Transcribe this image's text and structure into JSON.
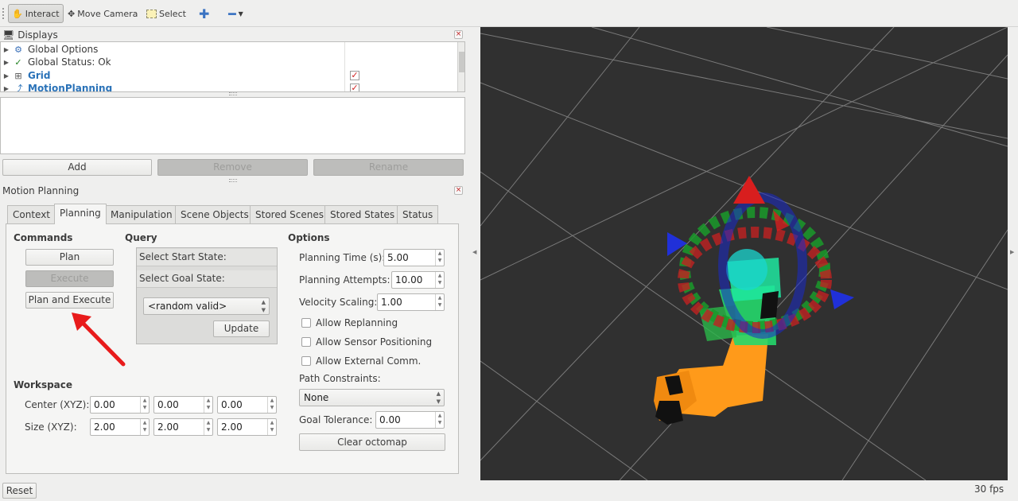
{
  "toolbar": {
    "interact": "Interact",
    "move_camera": "Move Camera",
    "select": "Select"
  },
  "displays": {
    "title": "Displays",
    "items": [
      {
        "label": "Global Options"
      },
      {
        "label": "Global Status: Ok"
      },
      {
        "label": "Grid"
      },
      {
        "label": "MotionPlanning"
      }
    ],
    "buttons": {
      "add": "Add",
      "remove": "Remove",
      "rename": "Rename"
    }
  },
  "motion_planning": {
    "title": "Motion Planning",
    "tabs": [
      "Context",
      "Planning",
      "Manipulation",
      "Scene Objects",
      "Stored Scenes",
      "Stored States",
      "Status"
    ],
    "commands": {
      "header": "Commands",
      "plan": "Plan",
      "execute": "Execute",
      "plan_and_execute": "Plan and Execute"
    },
    "query": {
      "header": "Query",
      "select_start": "Select Start State:",
      "select_goal": "Select Goal State:",
      "goal_option": "<random valid>",
      "update": "Update"
    },
    "options": {
      "header": "Options",
      "planning_time_label": "Planning Time (s):",
      "planning_time": "5.00",
      "planning_attempts_label": "Planning Attempts:",
      "planning_attempts": "10.00",
      "velocity_scaling_label": "Velocity Scaling:",
      "velocity_scaling": "1.00",
      "allow_replanning": "Allow Replanning",
      "allow_sensor": "Allow Sensor Positioning",
      "allow_external": "Allow External Comm.",
      "path_constraints_label": "Path Constraints:",
      "path_constraints": "None",
      "goal_tolerance_label": "Goal Tolerance:",
      "goal_tolerance": "0.00",
      "clear_octomap": "Clear octomap"
    },
    "workspace": {
      "header": "Workspace",
      "center_label": "Center (XYZ):",
      "center": [
        "0.00",
        "0.00",
        "0.00"
      ],
      "size_label": "Size (XYZ):",
      "size": [
        "2.00",
        "2.00",
        "2.00"
      ]
    }
  },
  "statusbar": {
    "reset": "Reset",
    "fps": "30 fps"
  },
  "colors": {
    "viewport_bg": "#303030",
    "accent_blue": "#2a72b8",
    "annotation_arrow": "#e81b1b",
    "robot_orange": "#ff9a1a"
  }
}
